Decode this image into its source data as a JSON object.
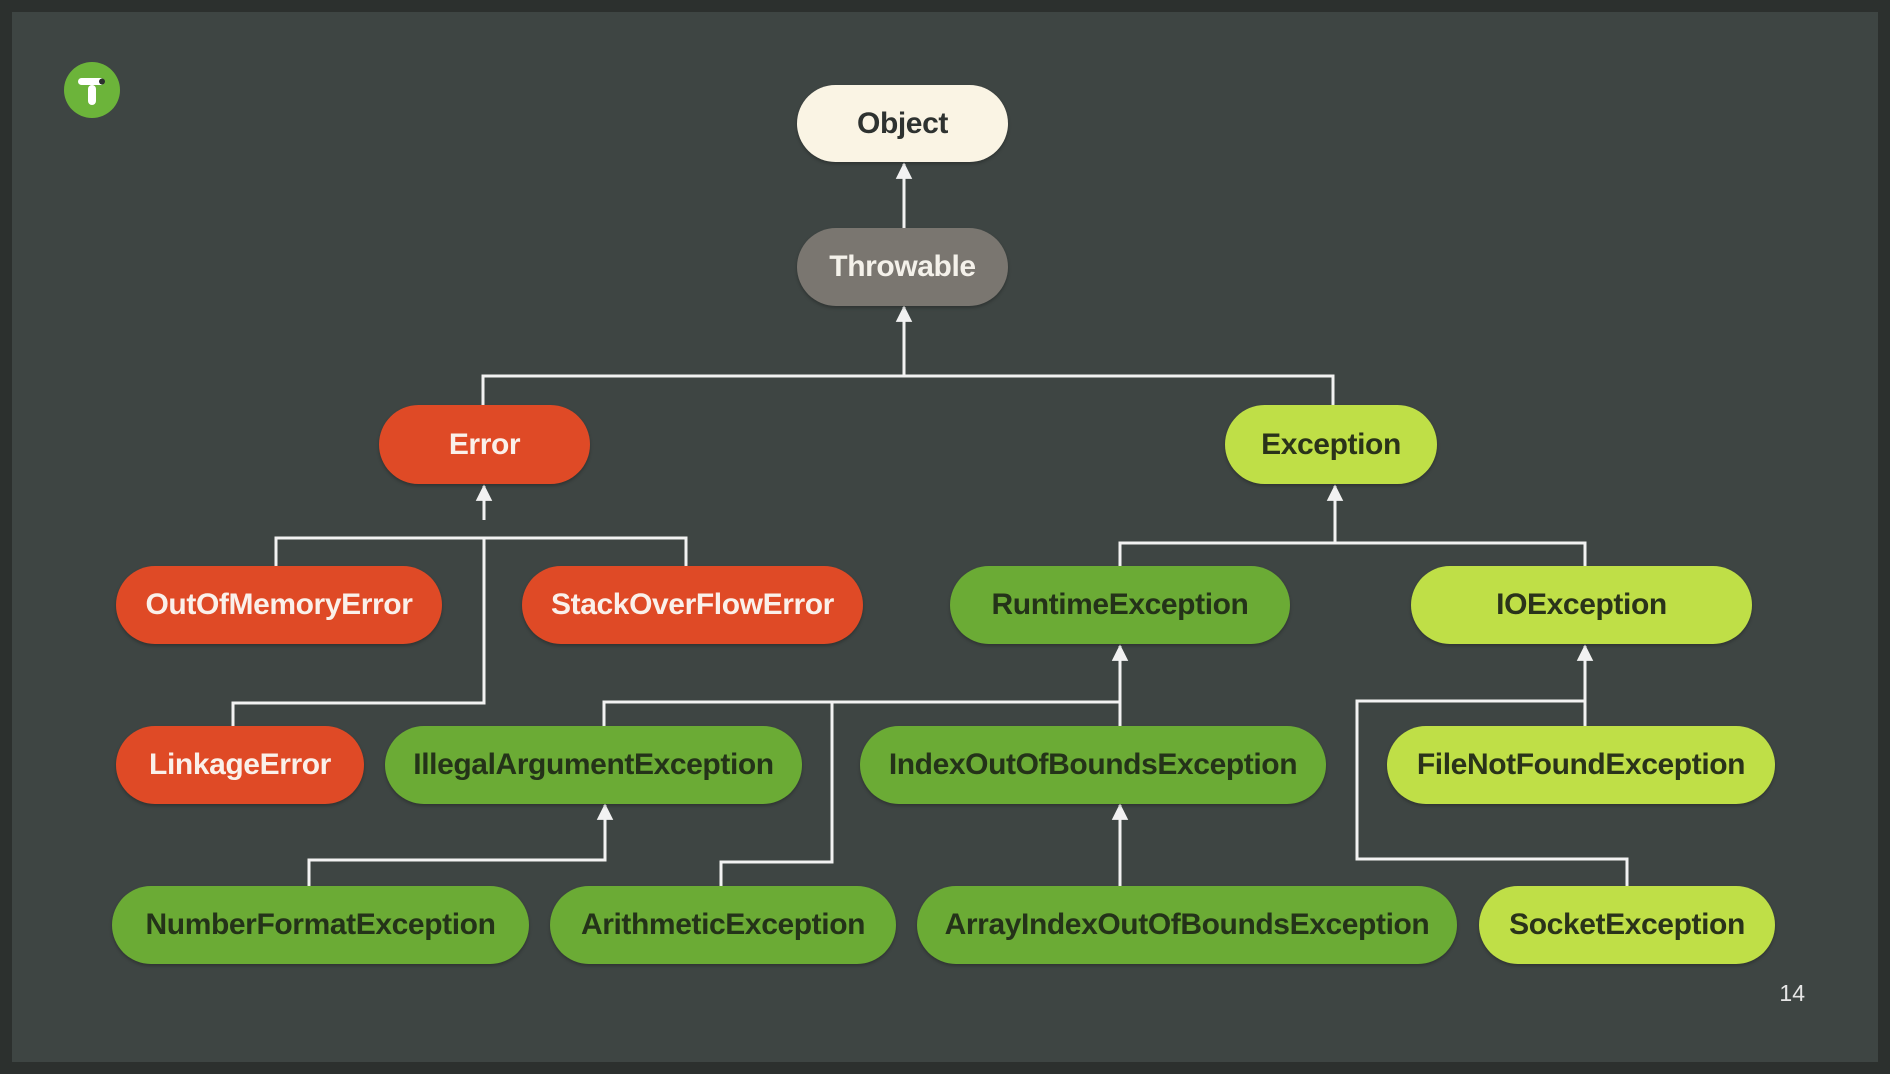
{
  "diagram": {
    "nodes": [
      {
        "id": "object",
        "label": "Object"
      },
      {
        "id": "throwable",
        "label": "Throwable"
      },
      {
        "id": "error",
        "label": "Error"
      },
      {
        "id": "exception",
        "label": "Exception"
      },
      {
        "id": "out-of-memory-error",
        "label": "OutOfMemoryError"
      },
      {
        "id": "stack-overflow-error",
        "label": "StackOverFlowError"
      },
      {
        "id": "runtime-exception",
        "label": "RuntimeException"
      },
      {
        "id": "io-exception",
        "label": "IOException"
      },
      {
        "id": "linkage-error",
        "label": "LinkageError"
      },
      {
        "id": "illegal-argument-exception",
        "label": "IllegalArgumentException"
      },
      {
        "id": "index-out-of-bounds-exception",
        "label": "IndexOutOfBoundsException"
      },
      {
        "id": "file-not-found-exception",
        "label": "FileNotFoundException"
      },
      {
        "id": "number-format-exception",
        "label": "NumberFormatException"
      },
      {
        "id": "arithmetic-exception",
        "label": "ArithmeticException"
      },
      {
        "id": "array-index-out-of-bounds-exception",
        "label": "ArrayIndexOutOfBoundsException"
      },
      {
        "id": "socket-exception",
        "label": "SocketException"
      }
    ],
    "edges": [
      {
        "from": "throwable",
        "to": "object"
      },
      {
        "from": "error",
        "to": "throwable"
      },
      {
        "from": "exception",
        "to": "throwable"
      },
      {
        "from": "out-of-memory-error",
        "to": "error"
      },
      {
        "from": "stack-overflow-error",
        "to": "error"
      },
      {
        "from": "linkage-error",
        "to": "error"
      },
      {
        "from": "runtime-exception",
        "to": "exception"
      },
      {
        "from": "io-exception",
        "to": "exception"
      },
      {
        "from": "illegal-argument-exception",
        "to": "runtime-exception"
      },
      {
        "from": "arithmetic-exception",
        "to": "runtime-exception"
      },
      {
        "from": "index-out-of-bounds-exception",
        "to": "runtime-exception"
      },
      {
        "from": "number-format-exception",
        "to": "illegal-argument-exception"
      },
      {
        "from": "array-index-out-of-bounds-exception",
        "to": "index-out-of-bounds-exception"
      },
      {
        "from": "file-not-found-exception",
        "to": "io-exception"
      },
      {
        "from": "socket-exception",
        "to": "io-exception"
      }
    ]
  },
  "colors": {
    "background": "#3e4543",
    "object": "#faf4e4",
    "throwable": "#7a7670",
    "error": "#df4a26",
    "runtime_green": "#6bab35",
    "io_lime": "#bfdf47",
    "connector": "#f2f2f2"
  },
  "logo": {
    "icon": "t-logo-icon",
    "color": "#6cb43a"
  },
  "page_number": "14"
}
